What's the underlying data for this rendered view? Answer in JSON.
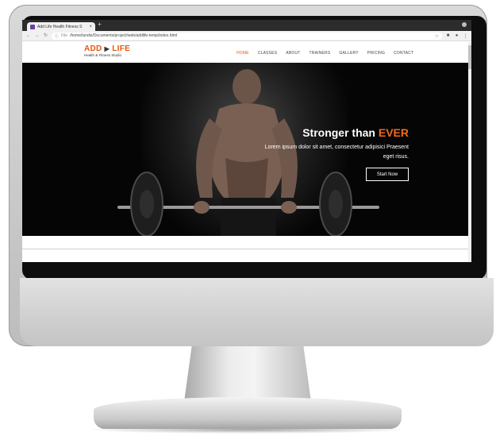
{
  "browser": {
    "tab_title": "Add Life Health Fitness S",
    "tab_close_icon": "close-icon",
    "new_tab_label": "+",
    "file_label": "File",
    "url": "/home/lundis/Documents/project/web/addlife-temp/index.html"
  },
  "site": {
    "logo": {
      "brand_left": "ADD",
      "brand_sep": "▶",
      "brand_right": "LIFE",
      "tagline": "Health & Fitness Studio"
    },
    "nav": [
      "HOME",
      "CLASSES",
      "ABOUT",
      "TRAINERS",
      "GALLERY",
      "PRICING",
      "CONTACT"
    ],
    "active_nav": "HOME",
    "hero": {
      "title_main": "Stronger than",
      "title_accent": "EVER",
      "body": "Lorem ipsum dolor sit amet, consectetur adipisici Praesent eget risus.",
      "button_label": "Start Now"
    }
  },
  "colors": {
    "accent": "#e8560e",
    "hero_accent": "#f26a1b",
    "hero_bg": "#050505",
    "tabbar_bg": "#2c2c2c"
  }
}
